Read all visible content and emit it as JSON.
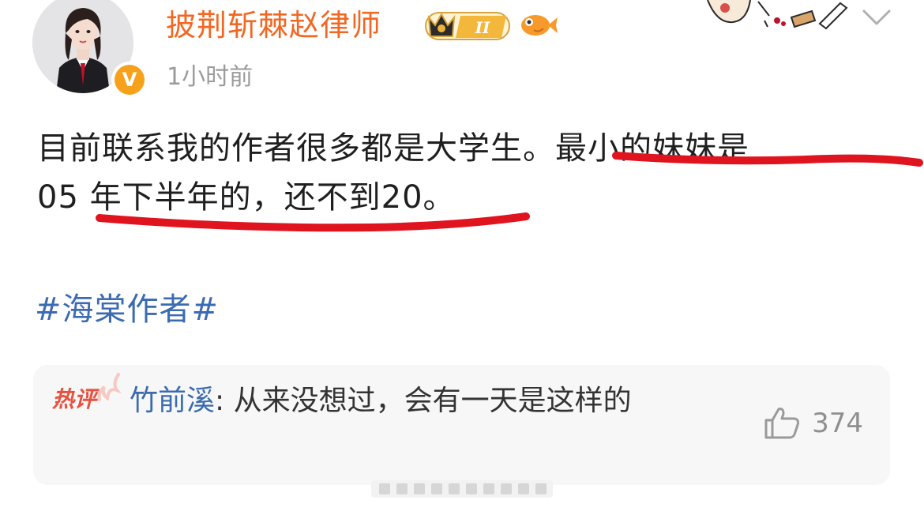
{
  "post": {
    "author": {
      "name": "披荆斩棘赵律师",
      "verified_icon": "orange-v-verified-icon"
    },
    "rank_badge": {
      "label": "II",
      "icon": "crown-icon"
    },
    "timestamp": "1小时前",
    "text": {
      "line1_a": "目前联系我的作者很多都是大学生。",
      "line1_b": "最小的妹妹是",
      "line2_a": "05",
      "line2_b": "年下半年的，还不到20。"
    },
    "hashtag": "#海棠作者#",
    "underline_color": "#e0141e"
  },
  "hot_comment": {
    "label": "热评",
    "commenter": "竹前溪",
    "separator": ": ",
    "text": "从来没想过，会有一天是这样的",
    "likes": "374"
  },
  "colors": {
    "username": "#f26722",
    "link": "#3b6bb0",
    "hot_label": "#e8503f",
    "timestamp": "#9b9b9b"
  }
}
